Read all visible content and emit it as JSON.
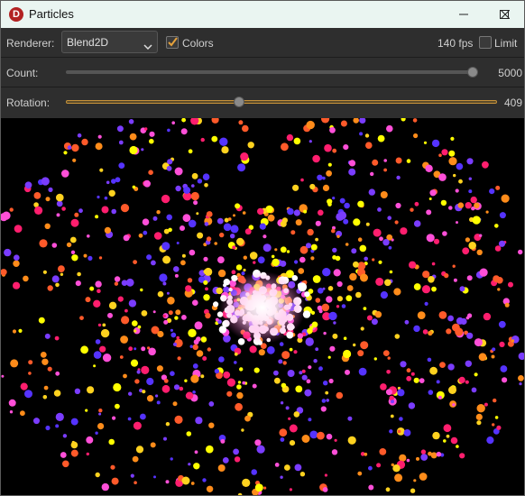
{
  "window": {
    "title": "Particles"
  },
  "toolbar": {
    "renderer_label": "Renderer:",
    "renderer_value": "Blend2D",
    "colors_label": "Colors",
    "colors_checked": true,
    "fps_text": "140 fps",
    "limit_label": "Limit",
    "limit_checked": false,
    "count_label": "Count:",
    "count_value": "5000",
    "count_level": 1.0,
    "rotation_label": "Rotation:",
    "rotation_value": "409",
    "rotation_level": 0.4
  },
  "colors": {
    "particles": [
      "#ff8c1a",
      "#ffff00",
      "#ff1e6e",
      "#7a3cff",
      "#5533ff",
      "#ff4fd8",
      "#ff5a2a",
      "#ffd21f"
    ],
    "checkmark": "#e6a23c",
    "rotation_track": "#c7923a"
  }
}
